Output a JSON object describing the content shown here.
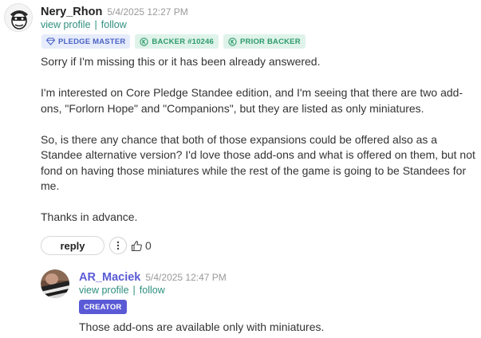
{
  "comment": {
    "author": "Nery_Rhon",
    "timestamp": "5/4/2025 12:27 PM",
    "view_profile": "view profile",
    "separator": "|",
    "follow": "follow",
    "badges": {
      "pledge_master": "PLEDGE MASTER",
      "backer": "BACKER #10246",
      "prior_backer": "PRIOR BACKER"
    },
    "paragraphs": [
      "Sorry if I'm missing this or it has been already answered.",
      "I'm interested on Core Pledge Standee edition, and I'm seeing that there are two add-ons, \"Forlorn Hope\" and \"Companions\", but they are listed as only miniatures.",
      "So, is there any chance that both of those expansions could be offered also as a Standee alternative version? I'd love those add-ons and what is offered on them, but not fond on having those miniatures while the rest of the game is going to be Standees for me.",
      "Thanks in advance."
    ],
    "reply_label": "reply",
    "like_count": "0"
  },
  "reply": {
    "author": "AR_Maciek",
    "timestamp": "5/4/2025 12:47 PM",
    "view_profile": "view profile",
    "separator": "|",
    "follow": "follow",
    "badge": "CREATOR",
    "text": "Those add-ons are available only with miniatures."
  },
  "colors": {
    "link": "#2f8f7f",
    "creator_name": "#5a5ad6",
    "creator_badge": "#5a5ad6",
    "pledge_badge_bg": "#e6ecfb",
    "backer_badge_bg": "#dff3ea"
  }
}
